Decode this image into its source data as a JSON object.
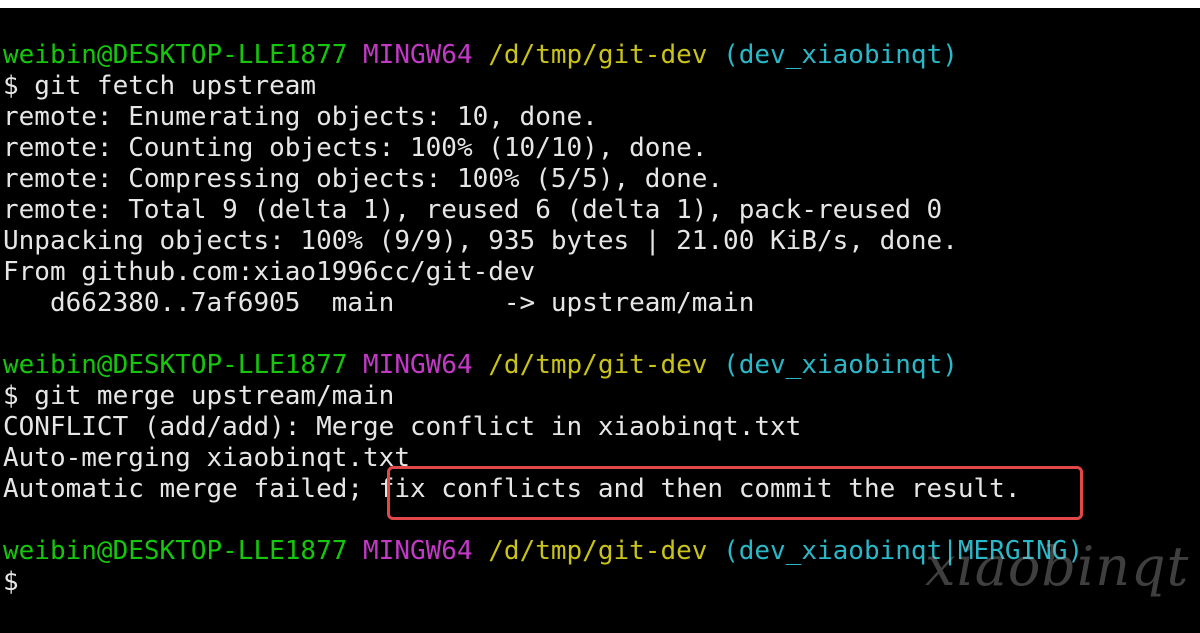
{
  "terminal": {
    "blocks": [
      {
        "prompt": {
          "user": "weibin@DESKTOP-LLE1877",
          "system": "MINGW64",
          "path": "/d/tmp/git-dev",
          "branch": "(dev_xiaobinqt)"
        },
        "command": "$ git fetch upstream",
        "output": [
          "remote: Enumerating objects: 10, done.",
          "remote: Counting objects: 100% (10/10), done.",
          "remote: Compressing objects: 100% (5/5), done.",
          "remote: Total 9 (delta 1), reused 6 (delta 1), pack-reused 0",
          "Unpacking objects: 100% (9/9), 935 bytes | 21.00 KiB/s, done.",
          "From github.com:xiao1996cc/git-dev",
          "   d662380..7af6905  main       -> upstream/main"
        ]
      },
      {
        "prompt": {
          "user": "weibin@DESKTOP-LLE1877",
          "system": "MINGW64",
          "path": "/d/tmp/git-dev",
          "branch": "(dev_xiaobinqt)"
        },
        "command": "$ git merge upstream/main",
        "output": [
          "CONFLICT (add/add): Merge conflict in xiaobinqt.txt",
          "Auto-merging xiaobinqt.txt"
        ],
        "failure_prefix": "Automatic merge failed; ",
        "failure_highlight": "fix conflicts and then commit the result."
      },
      {
        "prompt": {
          "user": "weibin@DESKTOP-LLE1877",
          "system": "MINGW64",
          "path": "/d/tmp/git-dev",
          "branch": "(dev_xiaobinqt|MERGING)"
        },
        "command": "$"
      }
    ]
  },
  "watermark": "xiaobinqt",
  "colors": {
    "background": "#000000",
    "user": "#16c60c",
    "system": "#c239c6",
    "path": "#c8c21a",
    "branch": "#2ab7c7",
    "text": "#e6e6e6",
    "highlight_border": "#e24848"
  }
}
